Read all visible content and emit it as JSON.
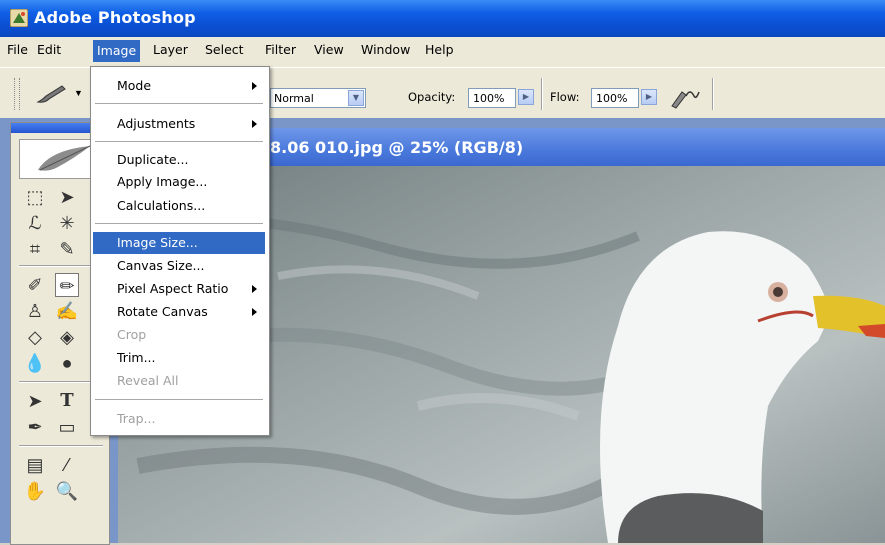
{
  "window": {
    "title": "Adobe Photoshop"
  },
  "menubar": {
    "items": [
      "File",
      "Edit",
      "Image",
      "Layer",
      "Select",
      "Filter",
      "View",
      "Window",
      "Help"
    ],
    "active": "Image"
  },
  "options_bar": {
    "mode_value": "Normal",
    "opacity_label": "Opacity:",
    "opacity_value": "100%",
    "flow_label": "Flow:",
    "flow_value": "100%"
  },
  "document": {
    "title_partial": "8.06 010.jpg @ 25% (RGB/8)"
  },
  "image_menu": {
    "items": [
      {
        "label": "Mode",
        "submenu": true,
        "enabled": true
      },
      {
        "label": "Adjustments",
        "submenu": true,
        "enabled": true
      },
      {
        "label": "Duplicate...",
        "enabled": true
      },
      {
        "label": "Apply Image...",
        "enabled": true
      },
      {
        "label": "Calculations...",
        "enabled": true
      },
      {
        "label": "Image Size...",
        "enabled": true,
        "highlighted": true
      },
      {
        "label": "Canvas Size...",
        "enabled": true
      },
      {
        "label": "Pixel Aspect Ratio",
        "submenu": true,
        "enabled": true
      },
      {
        "label": "Rotate Canvas",
        "submenu": true,
        "enabled": true
      },
      {
        "label": "Crop",
        "enabled": false
      },
      {
        "label": "Trim...",
        "enabled": true
      },
      {
        "label": "Reveal All",
        "enabled": false
      },
      {
        "label": "Trap...",
        "enabled": false
      }
    ]
  },
  "colors": {
    "titlebar": "#0b4fd2",
    "highlight": "#316ac5",
    "menu_bg": "#ece9d8"
  }
}
